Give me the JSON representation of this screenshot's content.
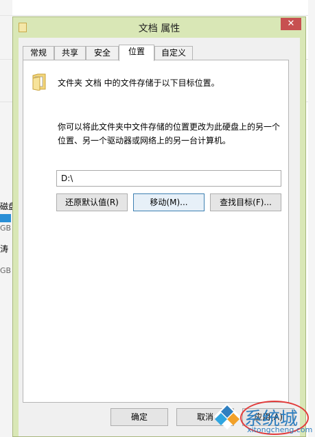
{
  "background": {
    "text1": "磁盘",
    "text2": "GB",
    "text3": "涛",
    "text4": "GB"
  },
  "dialog": {
    "title": "文档 属性",
    "close": "✕",
    "tabs": [
      {
        "label": "常规"
      },
      {
        "label": "共享"
      },
      {
        "label": "安全"
      },
      {
        "label": "位置"
      },
      {
        "label": "自定义"
      }
    ],
    "active_tab": "位置",
    "location_desc": "文件夹 文档 中的文件存储于以下目标位置。",
    "move_desc": "你可以将此文件夹中文件存储的位置更改为此硬盘上的另一个位置、另一个驱动器或网络上的另一台计算机。",
    "path_value": "D:\\",
    "buttons": {
      "restore": "还原默认值(R)",
      "move": "移动(M)...",
      "find": "查找目标(F)..."
    },
    "footer": {
      "ok": "确定",
      "cancel": "取消",
      "apply": "应用(A)"
    }
  },
  "watermark": {
    "text": "系统城",
    "url": "xitongcheng.com"
  },
  "colors": {
    "titlebar": "#d9e7b6",
    "close": "#c75050",
    "accent": "#2f7fc0"
  }
}
